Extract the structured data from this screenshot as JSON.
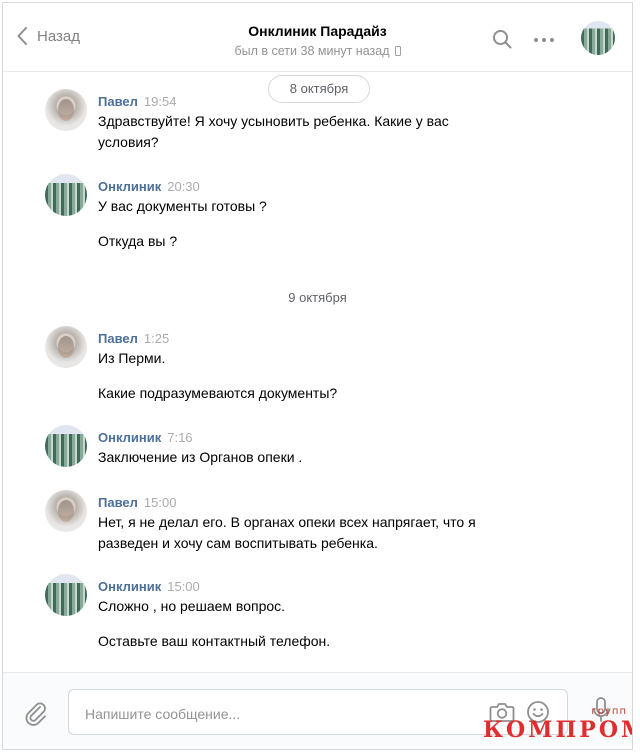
{
  "header": {
    "back_label": "Назад",
    "title": "Онклиник Парадайз",
    "status": "был в сети 38 минут назад"
  },
  "dates": [
    "8 октября",
    "9 октября"
  ],
  "messages": [
    {
      "author": "Павел",
      "time": "19:54",
      "lines": [
        "Здравствуйте! Я хочу усыновить ребенка. Какие у вас условия?"
      ]
    },
    {
      "author": "Онклиник",
      "time": "20:30",
      "lines": [
        "У вас документы готовы ?",
        "Откуда вы ?"
      ]
    },
    {
      "author": "Павел",
      "time": "1:25",
      "lines": [
        "Из Перми.",
        "Какие подразумеваются документы?"
      ]
    },
    {
      "author": "Онклиник",
      "time": "7:16",
      "lines": [
        "Заключение из Органов опеки ."
      ]
    },
    {
      "author": "Павел",
      "time": "15:00",
      "lines": [
        "Нет, я не делал его. В органах опеки всех напрягает, что я разведен и хочу сам воспитывать ребенка."
      ]
    },
    {
      "author": "Онклиник",
      "time": "15:00",
      "lines": [
        "Сложно , но решаем вопрос.",
        "Оставьте ваш контактный телефон."
      ]
    }
  ],
  "composer": {
    "placeholder": "Напишите сообщение..."
  },
  "watermark": {
    "small": "групп",
    "big": "КОМПРОМАТ"
  },
  "colors": {
    "author": "#4d6f99",
    "watermark": "#e02d2d"
  }
}
